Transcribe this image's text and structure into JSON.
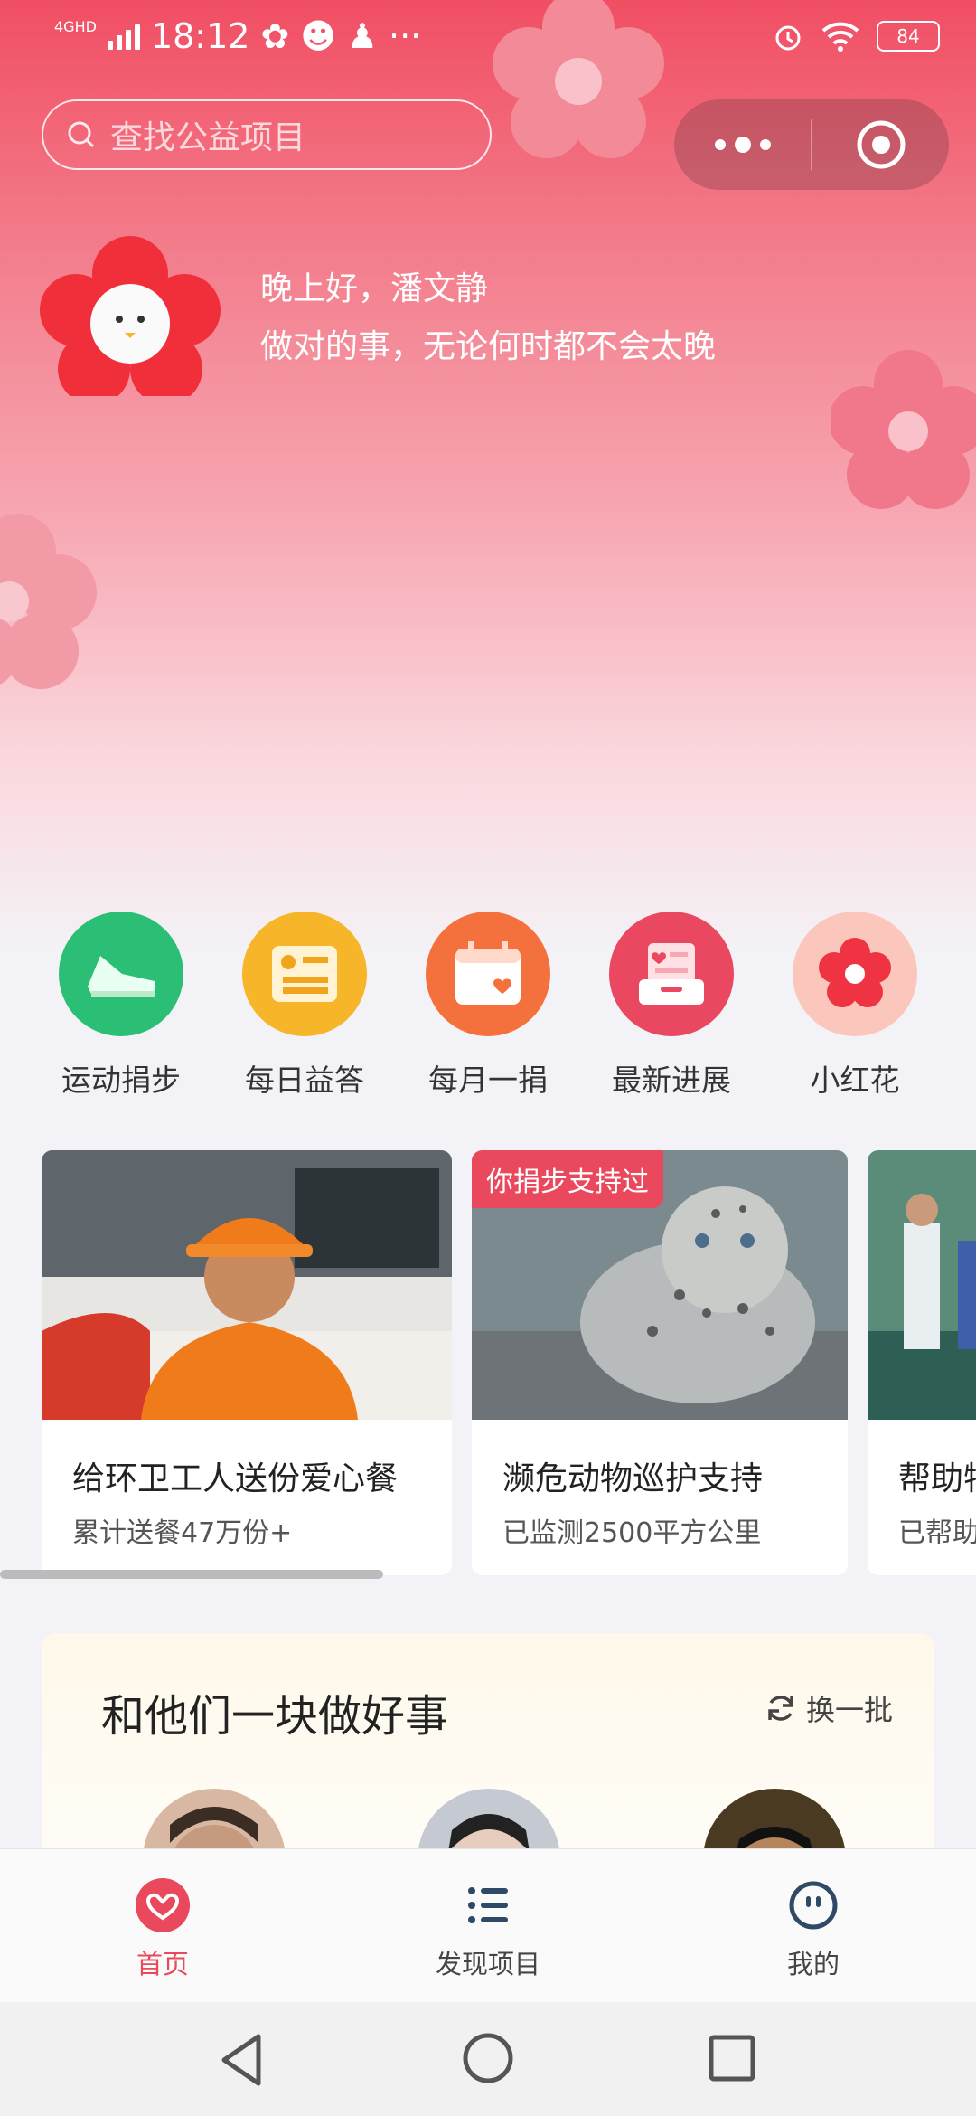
{
  "status_bar": {
    "network": "4GHD",
    "time": "18:12",
    "battery": "84"
  },
  "search": {
    "placeholder": "查找公益项目"
  },
  "greeting": {
    "line1": "晚上好，潘文静",
    "line2": "做对的事，无论何时都不会太晚"
  },
  "shortcuts": [
    {
      "label": "运动捐步",
      "icon": "sneaker-icon",
      "color": "#2bbf76"
    },
    {
      "label": "每日益答",
      "icon": "quiz-card-icon",
      "color": "#f7b52a"
    },
    {
      "label": "每月一捐",
      "icon": "calendar-heart-icon",
      "color": "#f4703c"
    },
    {
      "label": "最新进展",
      "icon": "inbox-heart-icon",
      "color": "#e94860"
    },
    {
      "label": "小红花",
      "icon": "red-flower-icon",
      "color": "#fbc7bd"
    }
  ],
  "projects": [
    {
      "title": "给环卫工人送份爱心餐",
      "subtitle": "累计送餐47万份+",
      "tag": ""
    },
    {
      "title": "濒危动物巡护支持",
      "subtitle": "已监测2500平方公里",
      "tag": "你捐步支持过"
    },
    {
      "title": "帮助特",
      "subtitle": "已帮助",
      "tag": ""
    }
  ],
  "together": {
    "heading": "和他们一块做好事",
    "refresh_label": "换一批"
  },
  "tabs": [
    {
      "label": "首页",
      "active": true,
      "color": "#e9485d"
    },
    {
      "label": "发现项目",
      "active": false,
      "color": "#444444"
    },
    {
      "label": "我的",
      "active": false,
      "color": "#444444"
    }
  ]
}
